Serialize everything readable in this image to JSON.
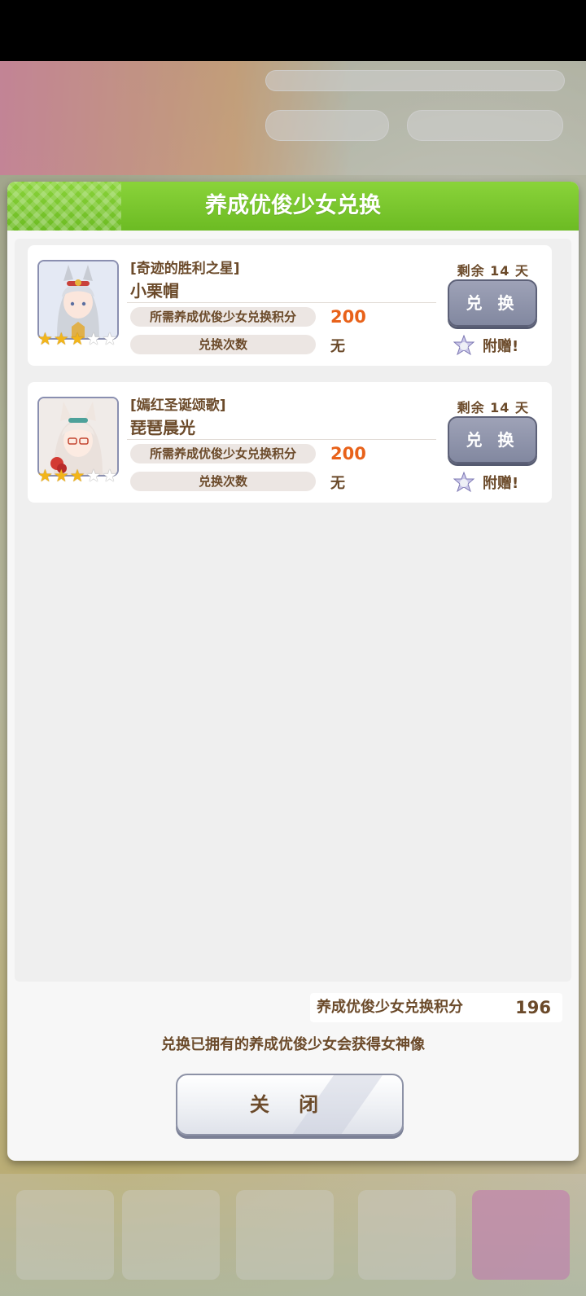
{
  "dialog": {
    "title": "养成优俊少女兑换",
    "close_label": "关 闭",
    "note": "兑换已拥有的养成优俊少女会获得女神像"
  },
  "items": [
    {
      "epithet": "[奇迹的胜利之星]",
      "name": "小栗帽",
      "remaining": "剩余 14 天",
      "points_label": "所需养成优俊少女兑换积分",
      "points": "200",
      "count_label": "兑换次数",
      "count": "无",
      "exchange_label": "兑 换",
      "bonus_label": "附赠!",
      "stars_total": 5,
      "stars_filled": 3
    },
    {
      "epithet": "[嫣红圣诞颂歌]",
      "name": "琵琶晨光",
      "remaining": "剩余 14 天",
      "points_label": "所需养成优俊少女兑换积分",
      "points": "200",
      "count_label": "兑换次数",
      "count": "无",
      "exchange_label": "兑 换",
      "bonus_label": "附赠!",
      "stars_total": 5,
      "stars_filled": 3
    }
  ],
  "wallet": {
    "label": "养成优俊少女兑换积分",
    "value": "196"
  },
  "colors": {
    "header_green": "#7ac62e",
    "text_brown": "#6b4a2a",
    "points_orange": "#e8621a",
    "button_gray": "#8f94ab"
  }
}
